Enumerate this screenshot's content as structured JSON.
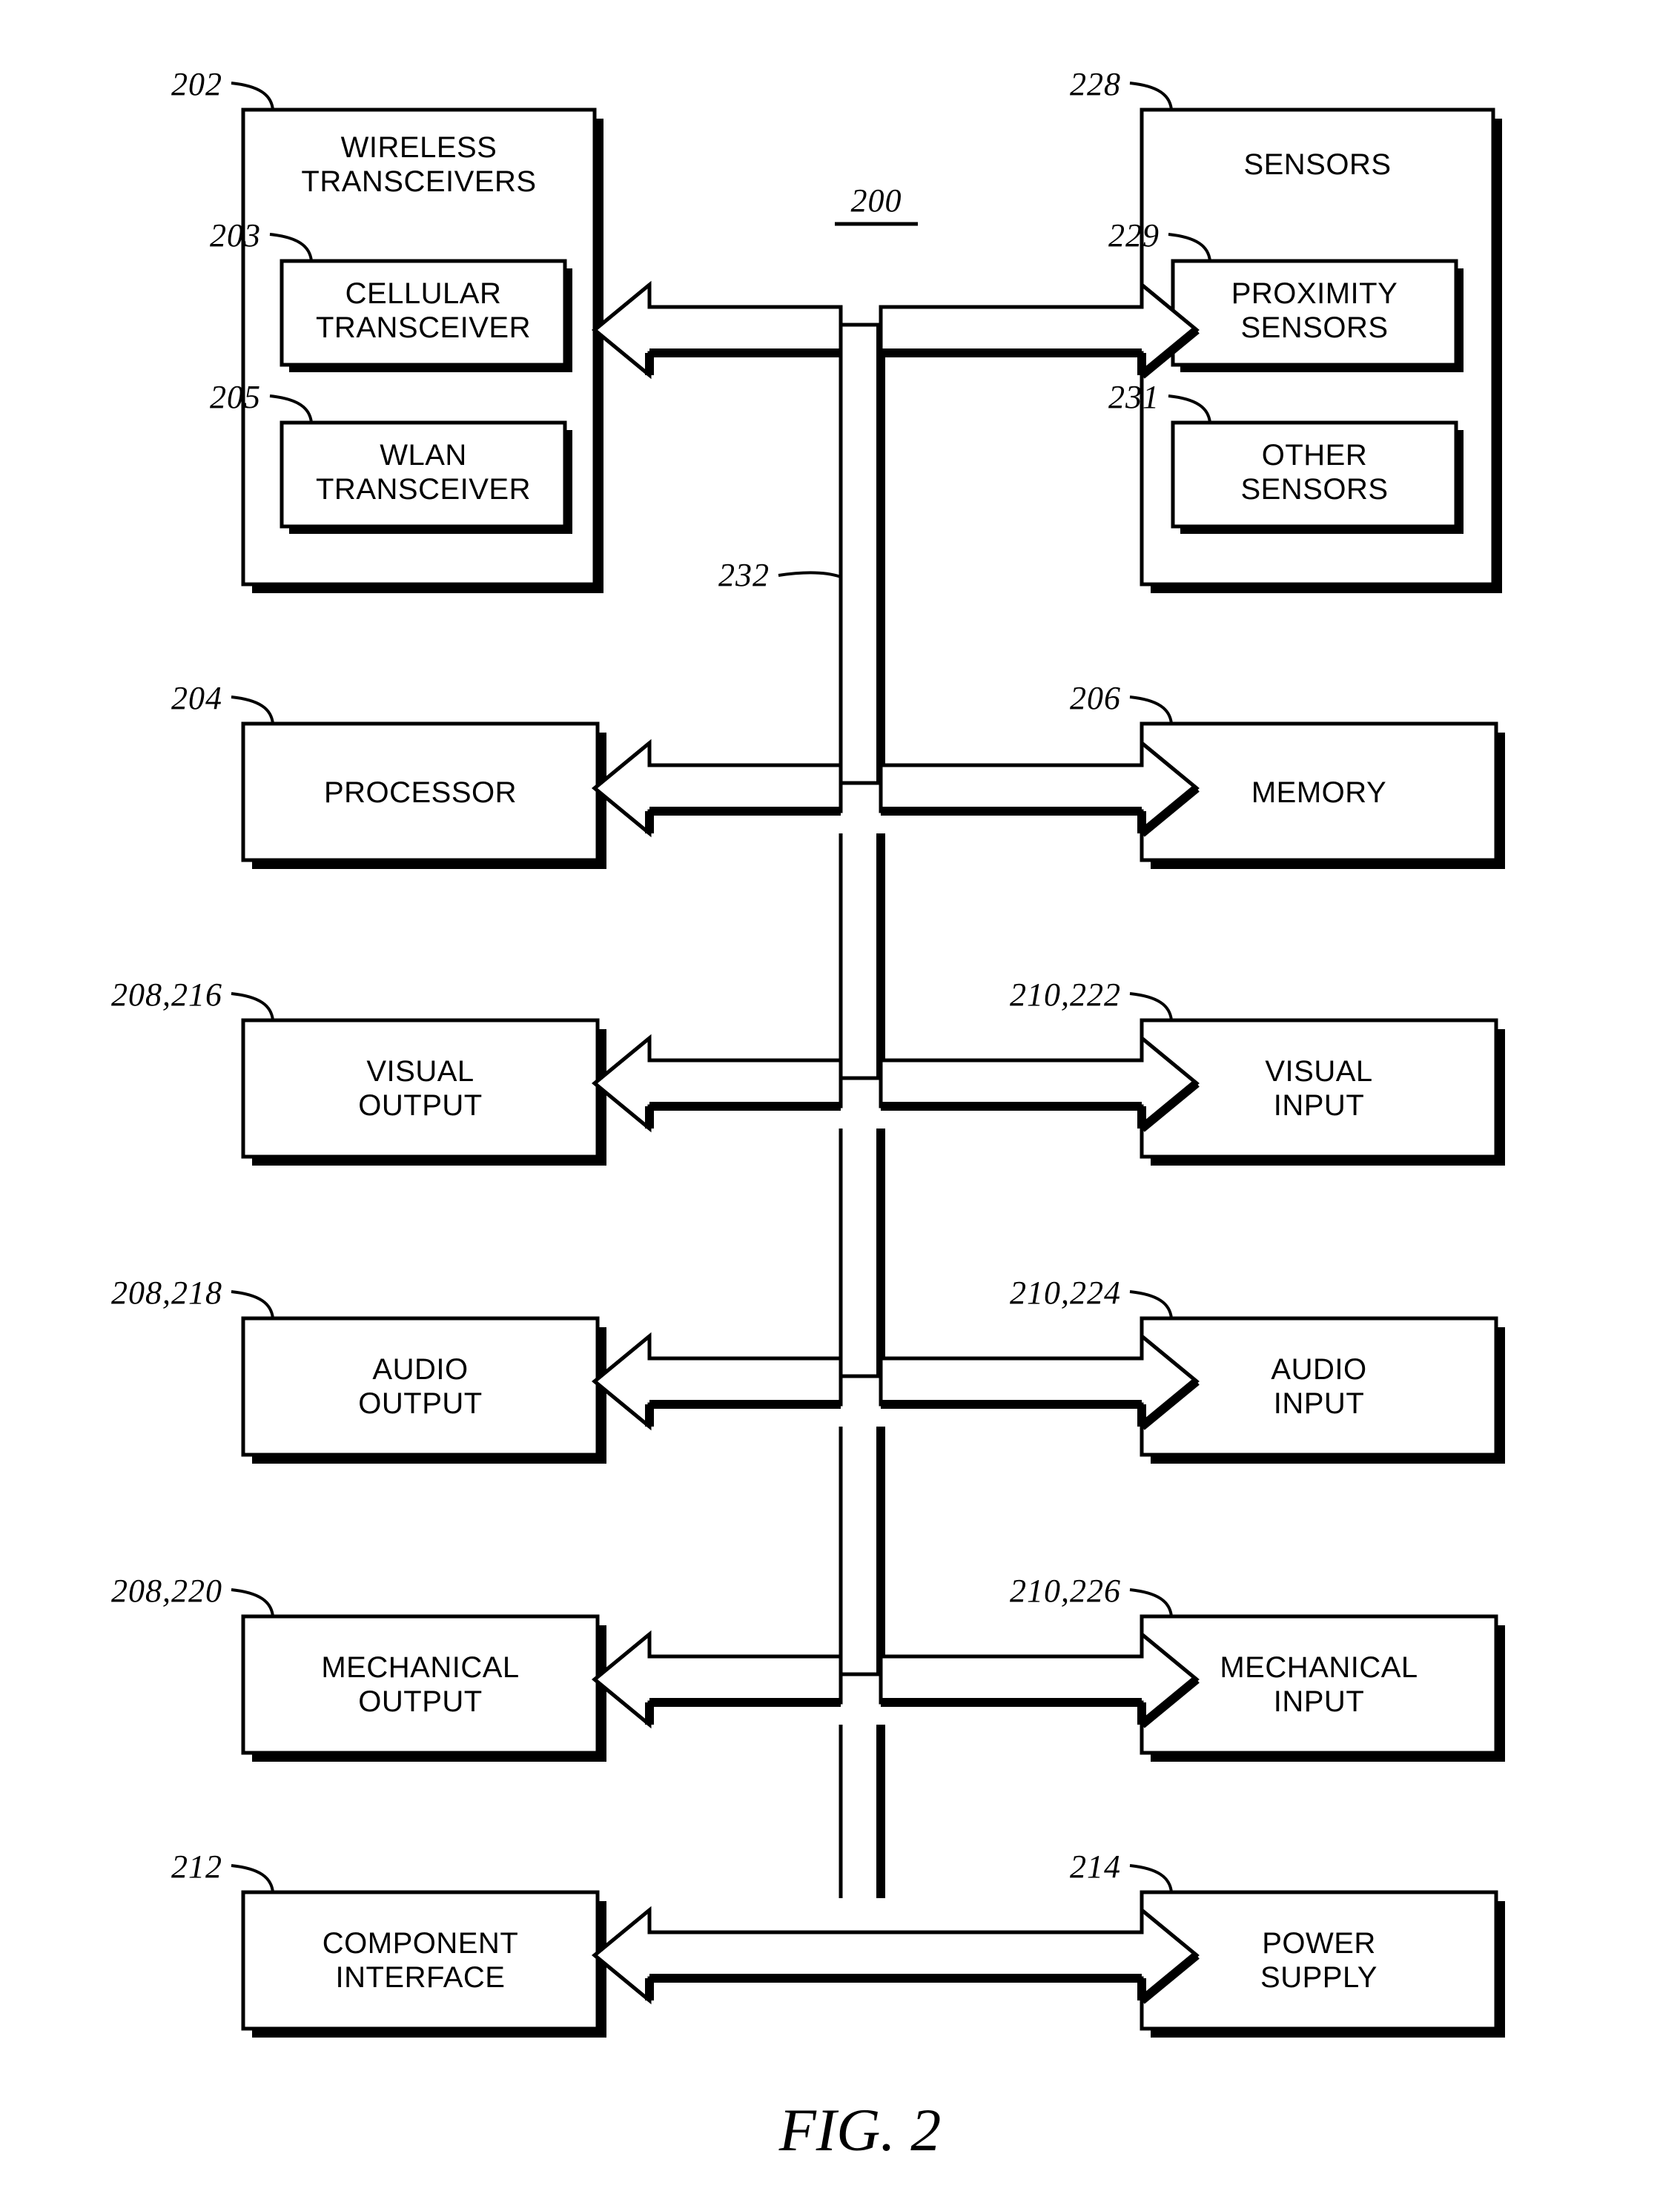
{
  "figure": {
    "caption": "FIG. 2",
    "system_ref": "200",
    "bus_ref": "232"
  },
  "blocks": [
    {
      "id": "wireless-transceivers",
      "ref": "202",
      "lines": [
        "WIRELESS",
        "TRANSCEIVERS"
      ],
      "side": "left",
      "children": [
        {
          "id": "cellular-transceiver",
          "ref": "203",
          "lines": [
            "CELLULAR",
            "TRANSCEIVER"
          ]
        },
        {
          "id": "wlan-transceiver",
          "ref": "205",
          "lines": [
            "WLAN",
            "TRANSCEIVER"
          ]
        }
      ]
    },
    {
      "id": "sensors",
      "ref": "228",
      "lines": [
        "SENSORS"
      ],
      "side": "right",
      "children": [
        {
          "id": "proximity-sensors",
          "ref": "229",
          "lines": [
            "PROXIMITY",
            "SENSORS"
          ]
        },
        {
          "id": "other-sensors",
          "ref": "231",
          "lines": [
            "OTHER",
            "SENSORS"
          ]
        }
      ]
    },
    {
      "id": "processor",
      "ref": "204",
      "lines": [
        "PROCESSOR"
      ],
      "side": "left"
    },
    {
      "id": "memory",
      "ref": "206",
      "lines": [
        "MEMORY"
      ],
      "side": "right"
    },
    {
      "id": "visual-output",
      "ref": "208,216",
      "lines": [
        "VISUAL",
        "OUTPUT"
      ],
      "side": "left"
    },
    {
      "id": "visual-input",
      "ref": "210,222",
      "lines": [
        "VISUAL",
        "INPUT"
      ],
      "side": "right"
    },
    {
      "id": "audio-output",
      "ref": "208,218",
      "lines": [
        "AUDIO",
        "OUTPUT"
      ],
      "side": "left"
    },
    {
      "id": "audio-input",
      "ref": "210,224",
      "lines": [
        "AUDIO",
        "INPUT"
      ],
      "side": "right"
    },
    {
      "id": "mechanical-output",
      "ref": "208,220",
      "lines": [
        "MECHANICAL",
        "OUTPUT"
      ],
      "side": "left"
    },
    {
      "id": "mechanical-input",
      "ref": "210,226",
      "lines": [
        "MECHANICAL",
        "INPUT"
      ],
      "side": "right"
    },
    {
      "id": "component-interface",
      "ref": "212",
      "lines": [
        "COMPONENT",
        "INTERFACE"
      ],
      "side": "left"
    },
    {
      "id": "power-supply",
      "ref": "214",
      "lines": [
        "POWER",
        "SUPPLY"
      ],
      "side": "right"
    }
  ],
  "labels": {
    "wireless_transceivers_l1": "WIRELESS",
    "wireless_transceivers_l2": "TRANSCEIVERS",
    "cellular_transceiver_l1": "CELLULAR",
    "cellular_transceiver_l2": "TRANSCEIVER",
    "wlan_transceiver_l1": "WLAN",
    "wlan_transceiver_l2": "TRANSCEIVER",
    "sensors_l1": "SENSORS",
    "proximity_sensors_l1": "PROXIMITY",
    "proximity_sensors_l2": "SENSORS",
    "other_sensors_l1": "OTHER",
    "other_sensors_l2": "SENSORS",
    "processor_l1": "PROCESSOR",
    "memory_l1": "MEMORY",
    "visual_output_l1": "VISUAL",
    "visual_output_l2": "OUTPUT",
    "visual_input_l1": "VISUAL",
    "visual_input_l2": "INPUT",
    "audio_output_l1": "AUDIO",
    "audio_output_l2": "OUTPUT",
    "audio_input_l1": "AUDIO",
    "audio_input_l2": "INPUT",
    "mechanical_output_l1": "MECHANICAL",
    "mechanical_output_l2": "OUTPUT",
    "mechanical_input_l1": "MECHANICAL",
    "mechanical_input_l2": "INPUT",
    "component_interface_l1": "COMPONENT",
    "component_interface_l2": "INTERFACE",
    "power_supply_l1": "POWER",
    "power_supply_l2": "SUPPLY"
  },
  "refs": {
    "r202": "202",
    "r203": "203",
    "r205": "205",
    "r228": "228",
    "r229": "229",
    "r231": "231",
    "r204": "204",
    "r206": "206",
    "r208_216": "208,216",
    "r210_222": "210,222",
    "r208_218": "208,218",
    "r210_224": "210,224",
    "r208_220": "208,220",
    "r210_226": "210,226",
    "r212": "212",
    "r214": "214",
    "r200": "200",
    "r232": "232"
  },
  "colors": {
    "ink": "#000000",
    "paper": "#ffffff"
  }
}
